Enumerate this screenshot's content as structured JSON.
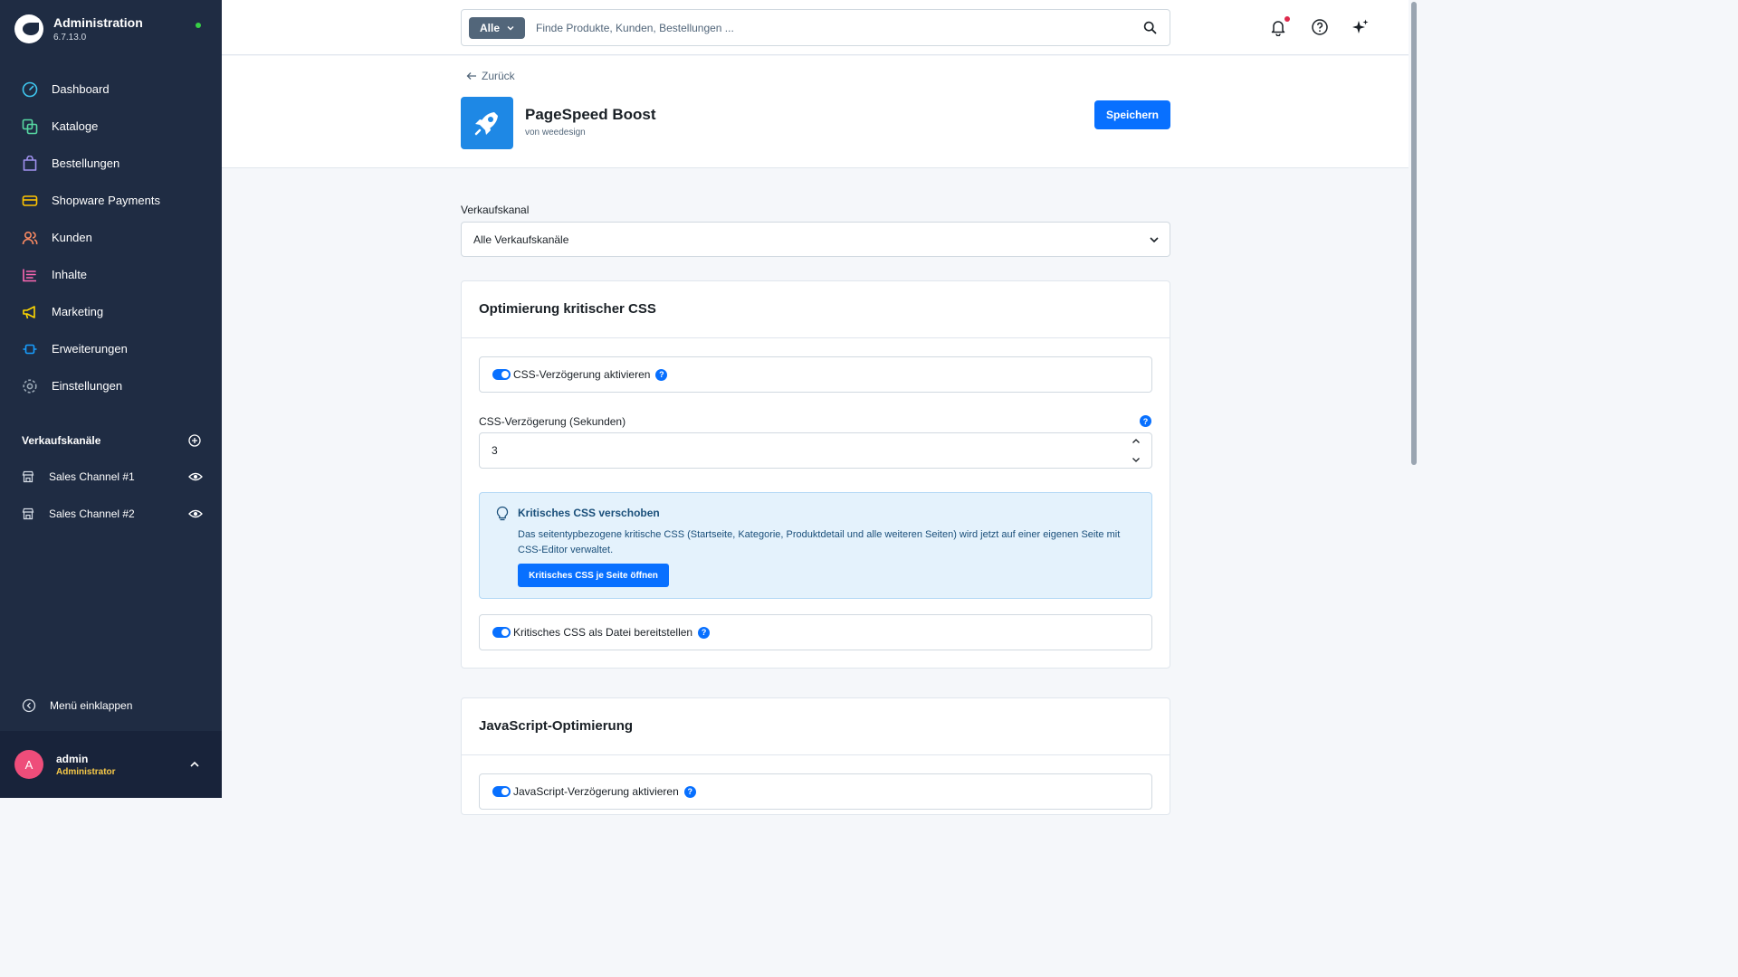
{
  "sidebar": {
    "brand_title": "Administration",
    "brand_version": "6.7.13.0",
    "items": [
      {
        "label": "Dashboard",
        "icon": "dashboard-icon",
        "color": "#3fc7f0"
      },
      {
        "label": "Kataloge",
        "icon": "catalog-icon",
        "color": "#57d9a3"
      },
      {
        "label": "Bestellungen",
        "icon": "orders-icon",
        "color": "#a092f0"
      },
      {
        "label": "Shopware Payments",
        "icon": "payments-icon",
        "color": "#ffc400"
      },
      {
        "label": "Kunden",
        "icon": "customers-icon",
        "color": "#f88962"
      },
      {
        "label": "Inhalte",
        "icon": "content-icon",
        "color": "#ff68b4"
      },
      {
        "label": "Marketing",
        "icon": "marketing-icon",
        "color": "#ffd700"
      },
      {
        "label": "Erweiterungen",
        "icon": "extensions-icon",
        "color": "#189eff"
      },
      {
        "label": "Einstellungen",
        "icon": "settings-icon",
        "color": "#9aa8b5"
      }
    ],
    "channels_title": "Verkaufskanäle",
    "channels": [
      {
        "label": "Sales Channel #1"
      },
      {
        "label": "Sales Channel #2"
      }
    ],
    "collapse_label": "Menü einklappen",
    "user": {
      "initial": "A",
      "name": "admin",
      "role": "Administrator"
    }
  },
  "topbar": {
    "search_type": "Alle",
    "search_placeholder": "Finde Produkte, Kunden, Bestellungen ..."
  },
  "header": {
    "back_label": "Zurück",
    "app_title": "PageSpeed Boost",
    "app_vendor": "von weedesign",
    "save_label": "Speichern"
  },
  "main": {
    "sales_channel_label": "Verkaufskanal",
    "sales_channel_value": "Alle Verkaufskanäle",
    "css_card": {
      "title": "Optimierung kritischer CSS",
      "css_delay_toggle_label": "CSS-Verzögerung aktivieren",
      "css_delay_seconds_label": "CSS-Verzögerung (Sekunden)",
      "css_delay_seconds_value": "3",
      "info_title": "Kritisches CSS verschoben",
      "info_text": "Das seitentypbezogene kritische CSS (Startseite, Kategorie, Produktdetail und alle weiteren Seiten) wird jetzt auf einer eigenen Seite mit CSS-Editor verwaltet.",
      "info_button": "Kritisches CSS je Seite öffnen",
      "critical_file_toggle_label": "Kritisches CSS als Datei bereitstellen"
    },
    "js_card": {
      "title": "JavaScript-Optimierung",
      "js_delay_toggle_label": "JavaScript-Verzögerung aktivieren"
    },
    "help_glyph": "?"
  },
  "colors": {
    "sidebar_bg": "#1f2c43",
    "primary": "#0870ff",
    "online": "#37d046",
    "notification": "#de294c",
    "avatar": "#ee4d7a",
    "role": "#f7c948"
  }
}
